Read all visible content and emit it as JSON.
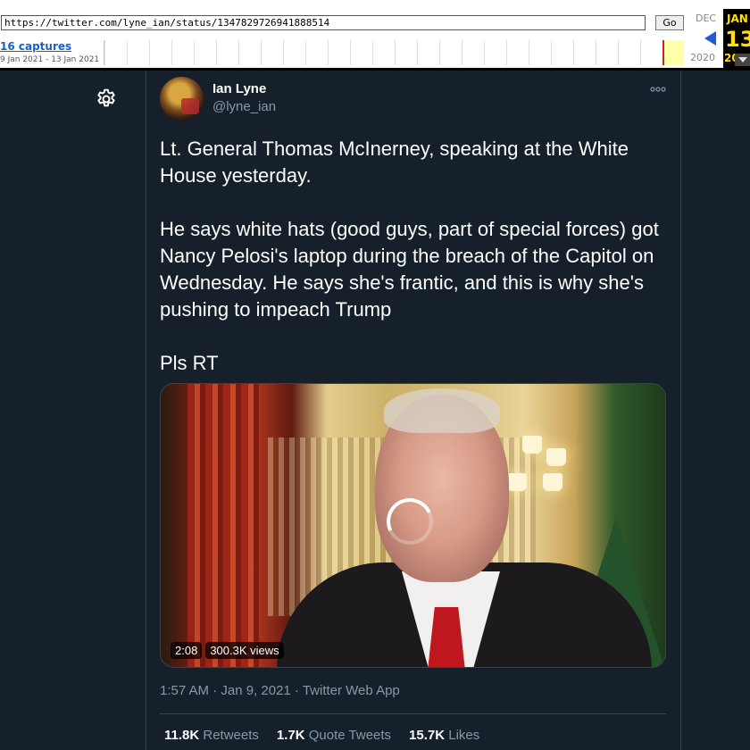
{
  "wayback": {
    "url": "https://twitter.com/lyne_ian/status/1347829726941888514",
    "go_label": "Go",
    "captures": "16 captures",
    "date_range": "9 Jan 2021 - 13 Jan 2021",
    "prev_month": "DEC",
    "prev_year": "2020",
    "current_month": "JAN",
    "current_day": "13",
    "current_year": "20",
    "accent_color": "#ffe000"
  },
  "tweet": {
    "author_name": "Ian Lyne",
    "author_handle": "@lyne_ian",
    "more_icon": "more-icon",
    "paragraphs": [
      "Lt. General Thomas McInerney, speaking at the White House yesterday.",
      "He says white hats (good guys, part of special forces) got Nancy Pelosi's laptop during the breach of the Capitol on Wednesday. He says she's frantic, and this is why she's pushing to impeach Trump",
      "Pls RT"
    ],
    "video": {
      "duration": "2:08",
      "views": "300.3K views"
    },
    "meta": "1:57 AM · Jan 9, 2021 · Twitter Web App",
    "stats": {
      "retweets_count": "11.8K",
      "retweets_label": "Retweets",
      "quotes_count": "1.7K",
      "quotes_label": "Quote Tweets",
      "likes_count": "15.7K",
      "likes_label": "Likes"
    }
  },
  "colors": {
    "background": "#15202b",
    "border": "#38444d",
    "secondary_text": "#8899a6"
  }
}
